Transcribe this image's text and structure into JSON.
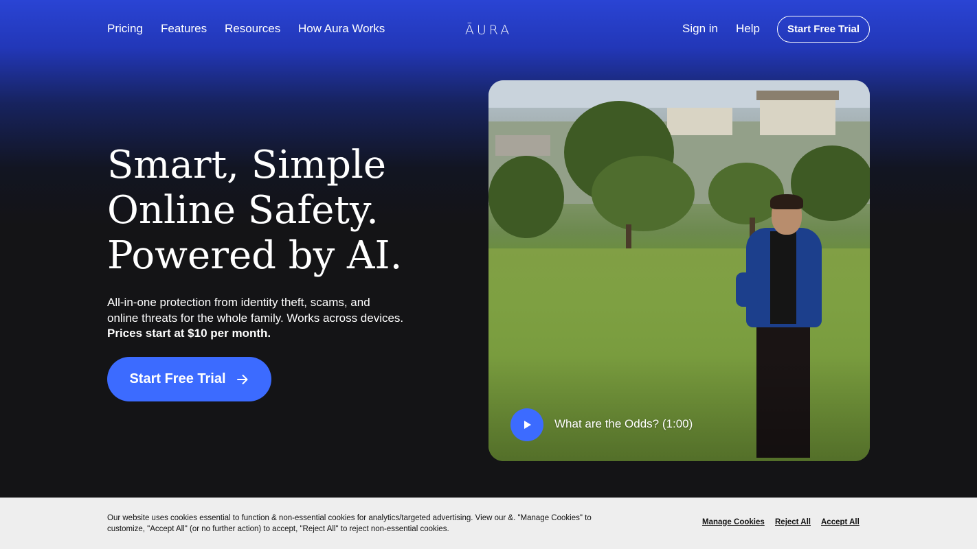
{
  "nav": {
    "left_links": [
      "Pricing",
      "Features",
      "Resources",
      "How Aura Works"
    ],
    "logo": "ĀURA",
    "sign_in": "Sign in",
    "help": "Help",
    "trial_button": "Start Free Trial"
  },
  "hero": {
    "title_lines": [
      "Smart, Simple",
      "Online Safety.",
      "Powered by AI."
    ],
    "subtitle_lines": [
      "All-in-one protection from identity theft, scams, and",
      "online threats for the whole family. Works across devices."
    ],
    "price_line": "Prices start at $10 per month.",
    "cta_label": "Start Free Trial",
    "cta_icon": "arrow-right-icon"
  },
  "video": {
    "caption": "What are the Odds? (1:00)",
    "play_icon": "play-icon"
  },
  "cookie_bar": {
    "text_lines": [
      "Our website uses cookies essential to function & non-essential cookies for analytics/targeted advertising. View our &. \"Manage Cookies\" to",
      "customize, \"Accept All\" (or no further action) to accept, \"Reject All\" to reject non-essential cookies."
    ],
    "manage": "Manage Cookies",
    "reject": "Reject All",
    "accept": "Accept All"
  },
  "colors": {
    "accent": "#3c6bff",
    "header_gradient_top": "#2a44d4",
    "background": "#141416",
    "cookie_bg": "#eeeeee"
  }
}
